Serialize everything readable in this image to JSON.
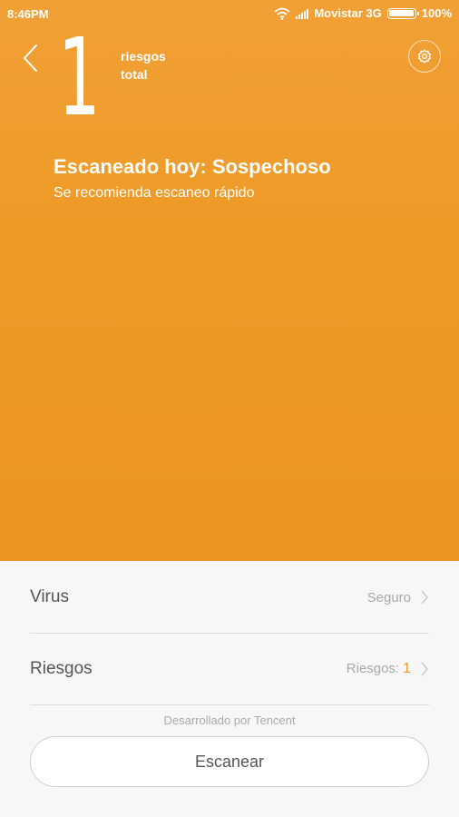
{
  "status_bar": {
    "time": "8:46PM",
    "carrier": "Movistar 3G",
    "battery": "100%"
  },
  "header": {
    "risk_count": "1",
    "risk_label_line1": "riesgos",
    "risk_label_line2": "total",
    "back_icon": "chevron-left-icon",
    "settings_icon": "gear-icon"
  },
  "scan_status": {
    "title": "Escaneado hoy: Sospechoso",
    "subtitle": "Se recomienda escaneo rápido"
  },
  "items": [
    {
      "label": "Virus",
      "value": "Seguro"
    },
    {
      "label": "Riesgos",
      "value_prefix": "Riesgos:",
      "value_count": "1"
    }
  ],
  "footer": {
    "developer": "Desarrollado por Tencent",
    "scan_button": "Escanear"
  },
  "colors": {
    "accent": "#ee9a27",
    "count_highlight": "#f09a23"
  }
}
